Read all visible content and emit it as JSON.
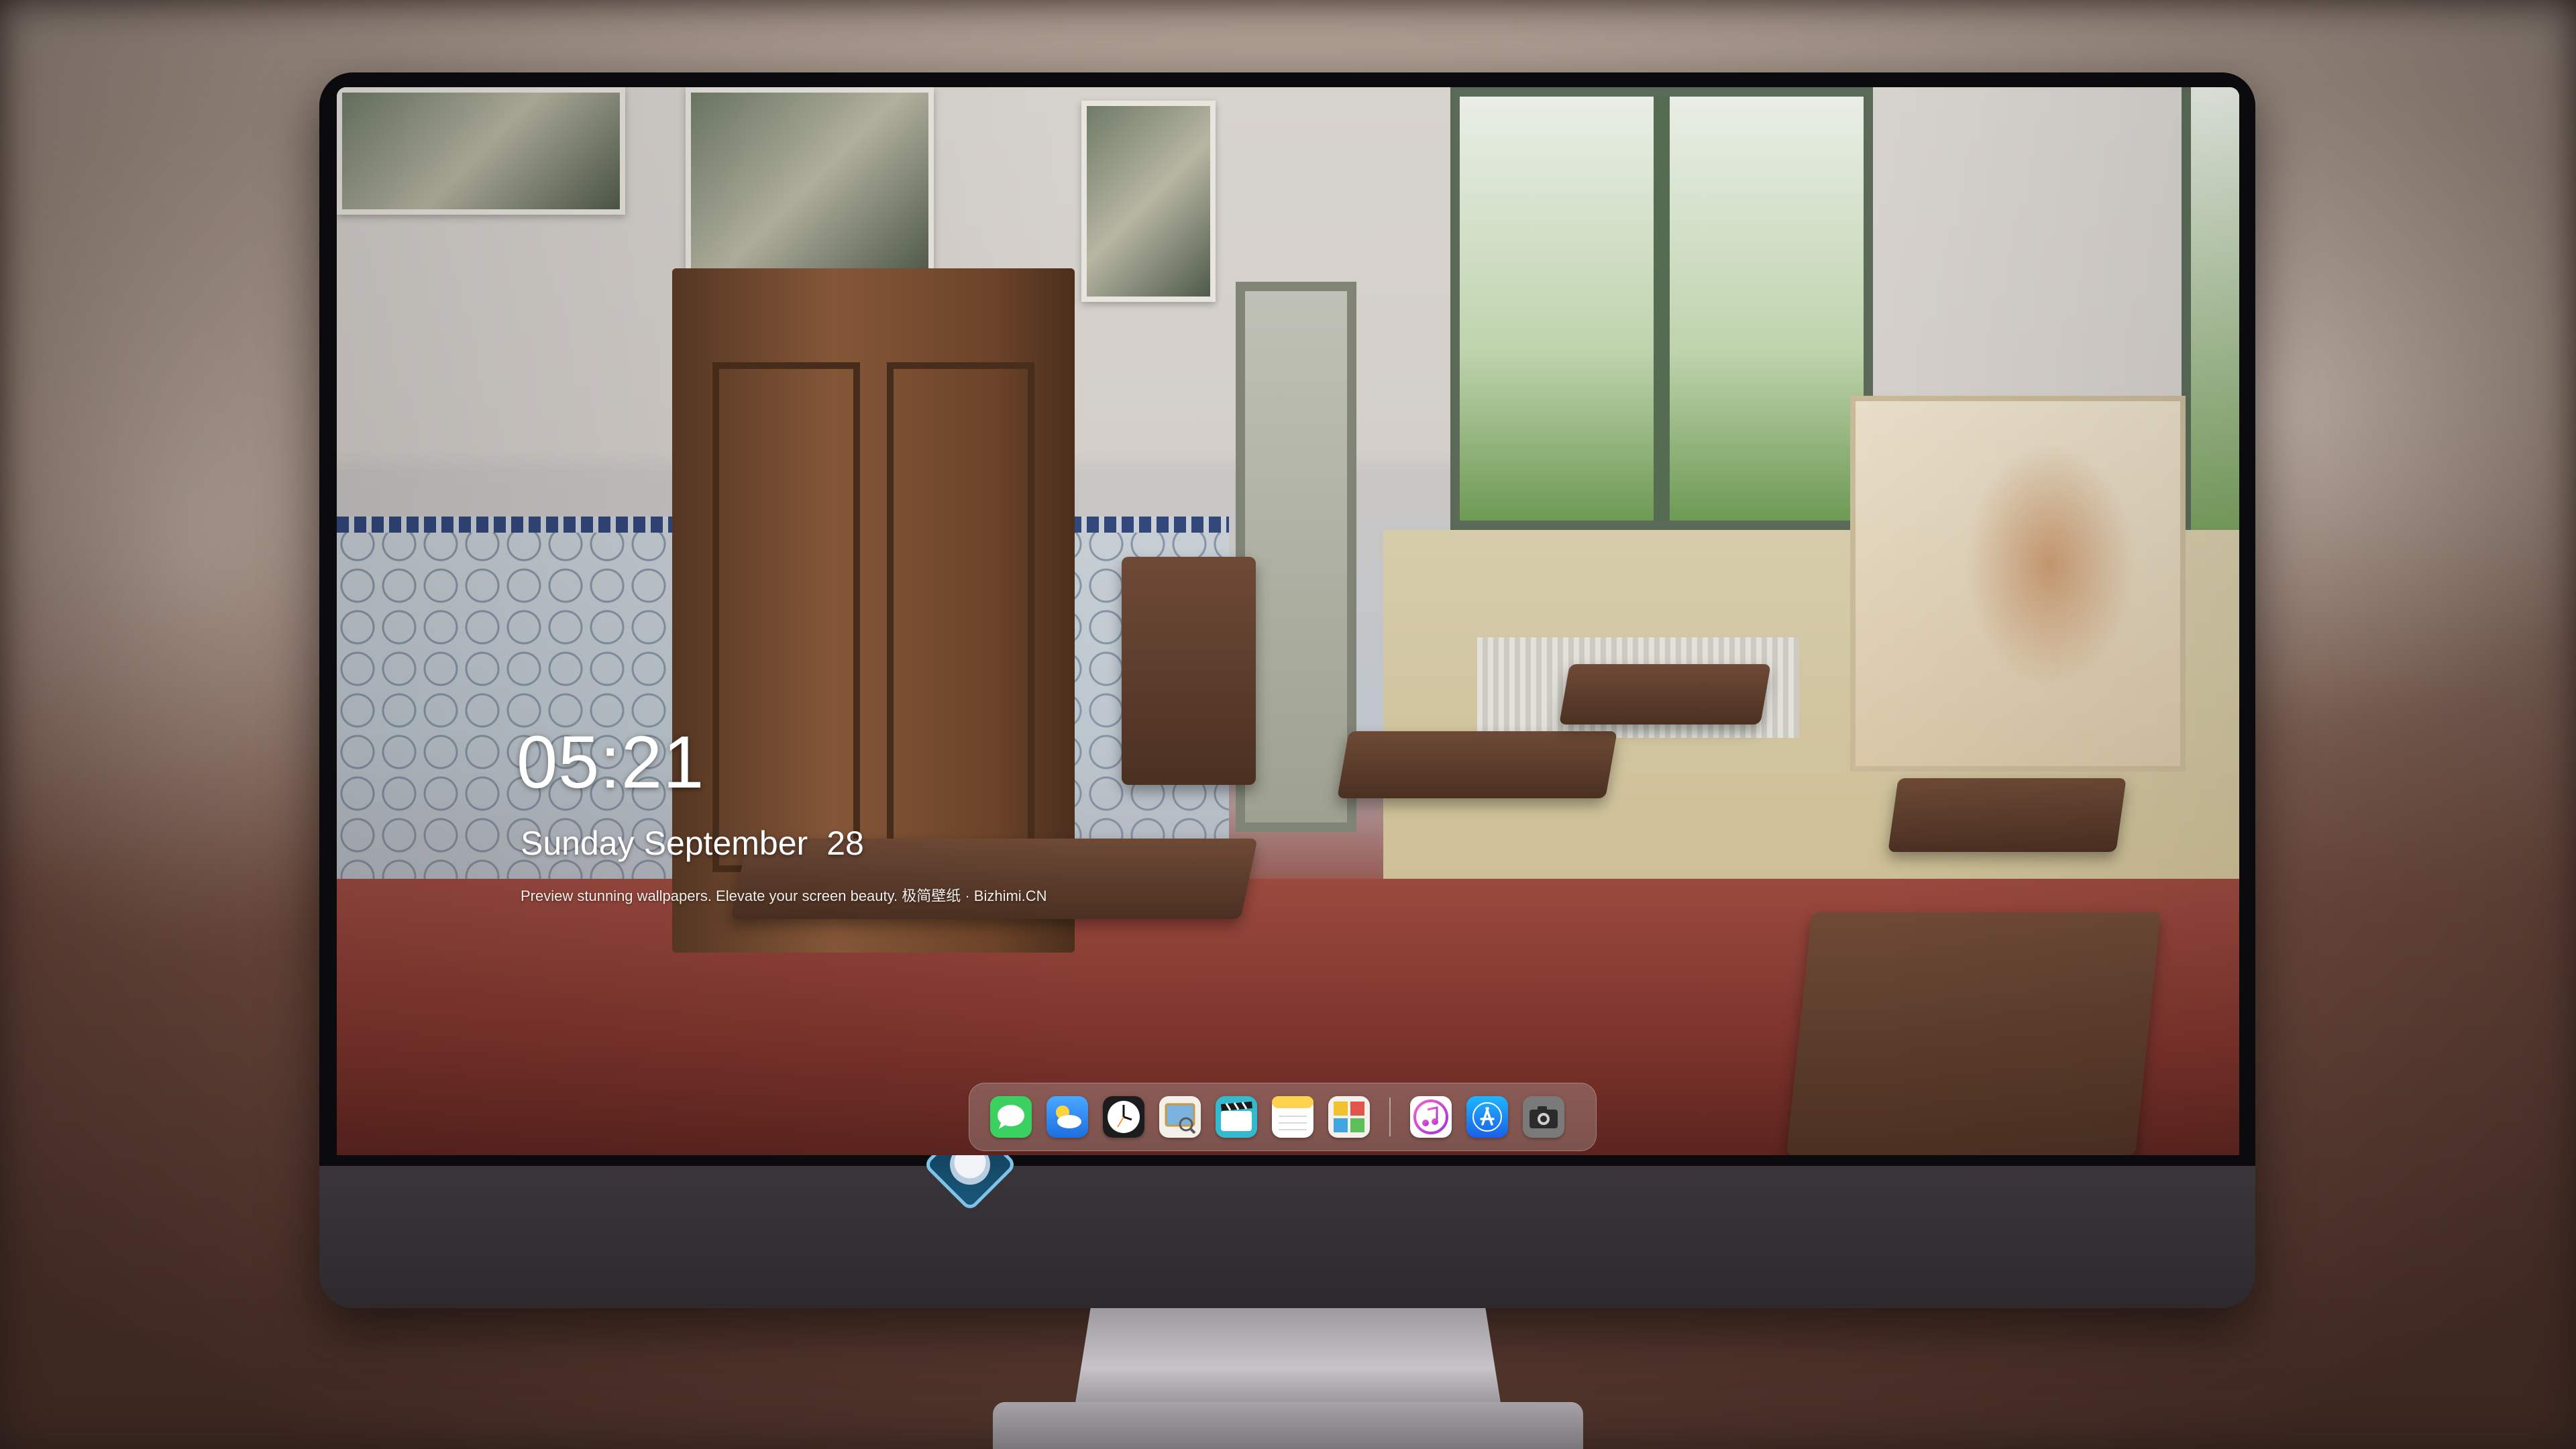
{
  "lockscreen": {
    "time": "05:21",
    "weekday": "Sunday",
    "month": "September",
    "day": "28",
    "tagline": "Preview stunning wallpapers. Elevate your screen beauty. 极简壁纸 · Bizhimi.CN"
  },
  "dock": {
    "items": [
      {
        "name": "messages",
        "icon": "messages-icon",
        "color": "#34c759"
      },
      {
        "name": "weather",
        "icon": "weather-icon",
        "color": "#2f8cf5"
      },
      {
        "name": "clock",
        "icon": "clock-icon",
        "color": "#ffffff"
      },
      {
        "name": "preview",
        "icon": "preview-icon",
        "color": "#d9a94a"
      },
      {
        "name": "clips",
        "icon": "clips-icon",
        "color": "#49c6d8"
      },
      {
        "name": "notes",
        "icon": "notes-icon",
        "color": "#ffd95a"
      },
      {
        "name": "photo-booth",
        "icon": "photo-booth-icon",
        "color": "#e25a4a"
      },
      {
        "name": "music",
        "icon": "music-icon",
        "color": "#e84bb8"
      },
      {
        "name": "app-store",
        "icon": "app-store-icon",
        "color": "#1e7cf2"
      },
      {
        "name": "camera",
        "icon": "camera-icon",
        "color": "#6e6e6e"
      }
    ]
  },
  "colors": {
    "clock_text": "#ffffff",
    "monitor_chin": "#2f2b2f",
    "logo_accent": "#7fc4e8"
  }
}
